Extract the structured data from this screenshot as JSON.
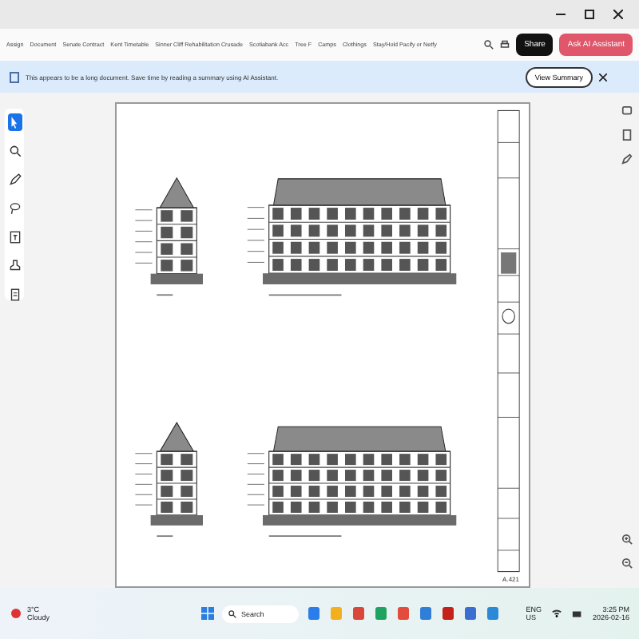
{
  "bookmarks": [
    "Assign",
    "Document",
    "Senate Contract",
    "Kent Timetable",
    "Sinner Cliff Rehabilitation Crusade",
    "Scotiabank Acc",
    "Tree F",
    "Camps",
    "Clothings",
    "Stay/Hold Pacify or Netfy"
  ],
  "toolbar": {
    "share": "Share",
    "assistant": "Ask AI Assistant"
  },
  "banner": {
    "message": "This appears to be a long document. Save time by reading a summary using AI Assistant.",
    "action": "View Summary"
  },
  "tools": [
    {
      "kind": "select",
      "selected": true
    },
    {
      "kind": "zoom",
      "selected": false
    },
    {
      "kind": "pen",
      "selected": false
    },
    {
      "kind": "lasso",
      "selected": false
    },
    {
      "kind": "text",
      "selected": false
    },
    {
      "kind": "stamp",
      "selected": false
    },
    {
      "kind": "page",
      "selected": false
    }
  ],
  "sheet": {
    "number": "A.421"
  },
  "taskbar": {
    "temperature": "3°C",
    "weather": "Cloudy",
    "search": "Search",
    "language": "ENG",
    "region": "US",
    "time": "3:25 PM",
    "date": "2026-02-16"
  }
}
